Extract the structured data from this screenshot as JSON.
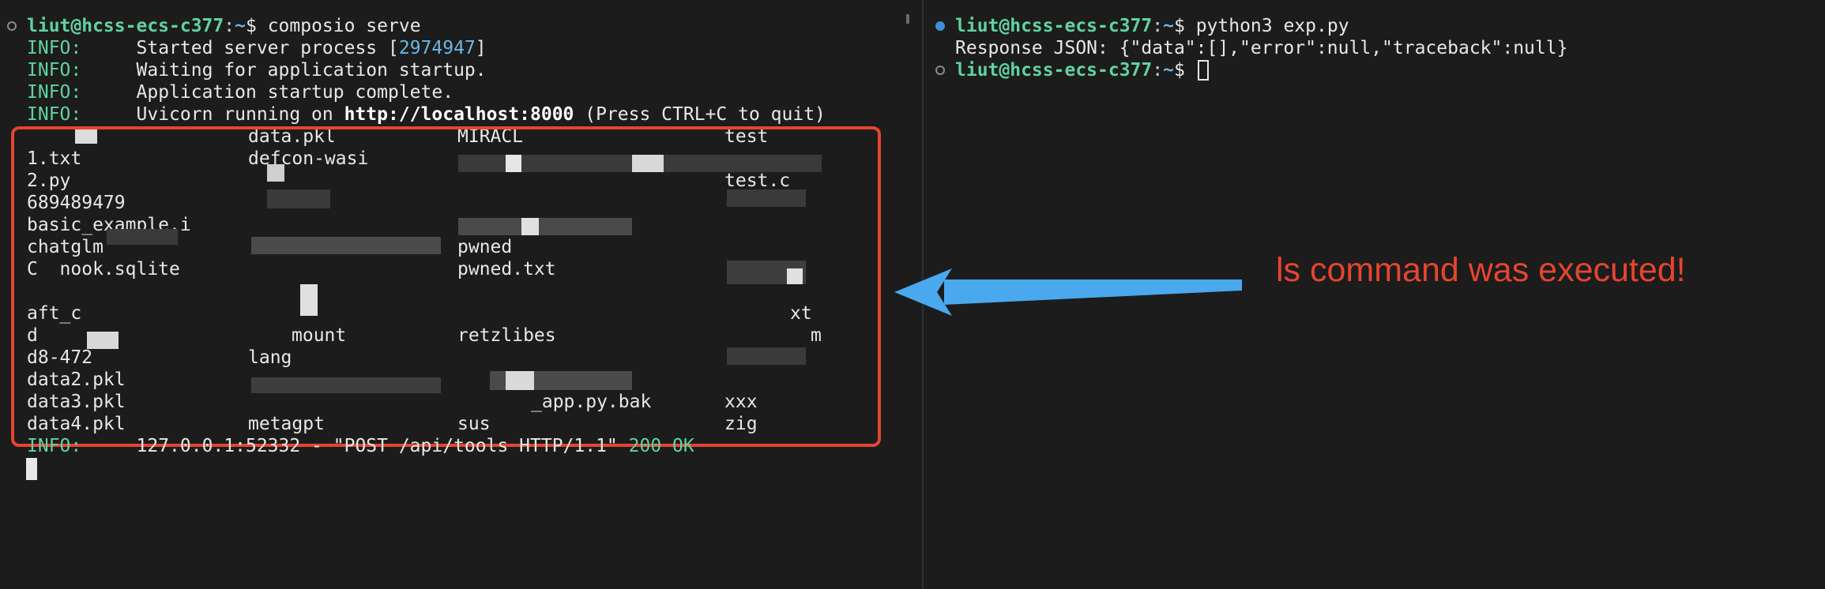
{
  "left_terminal": {
    "prompt": {
      "user_host": "liut@hcss-ecs-c377",
      "colon": ":",
      "path": "~",
      "dollar": "$",
      "command": "composio serve"
    },
    "log": [
      {
        "level": "INFO:",
        "message": "Started server process [",
        "pid": "2974947",
        "suffix": "]"
      },
      {
        "level": "INFO:",
        "message": "Waiting for application startup."
      },
      {
        "level": "INFO:",
        "message": "Application startup complete."
      },
      {
        "level": "INFO:",
        "message": "Uvicorn running on ",
        "url": "http://localhost:8000",
        "suffix": " (Press CTRL+C to quit)"
      }
    ],
    "listing": {
      "col1": [
        "1.txt",
        "2.py",
        "689489479",
        "basic_example.i",
        "chatglm",
        "C",
        "",
        "d",
        "d8-472",
        "data2.pkl",
        "data3.pkl",
        "data4.pkl"
      ],
      "col2": [
        "data.pkl",
        "defcon-wasi",
        "",
        "",
        "",
        "",
        "",
        "",
        "mount",
        "lang",
        "",
        "metagpt"
      ],
      "col3": [
        "MIRACL",
        "",
        "",
        "",
        "",
        "pwned",
        "pwned.txt",
        "",
        "retzlibes",
        "",
        "_app.py.bak",
        "sus"
      ],
      "col4": [
        "test",
        "",
        "test.c",
        "",
        "",
        "",
        "",
        "",
        "xt",
        "m",
        "xxx",
        "zig"
      ]
    },
    "partial_rows": {
      "row_chinook": "C  nook.sqlite",
      "row_draft": "aft_c"
    },
    "request_log": {
      "level": "INFO:",
      "message": "127.0.0.1:52332 - \"POST /api/tools HTTP/1.1\" ",
      "status": "200 OK"
    }
  },
  "right_terminal": {
    "prompt1": {
      "user_host": "liut@hcss-ecs-c377",
      "colon": ":",
      "path": "~",
      "dollar": "$",
      "command": "python3 exp.py"
    },
    "response": "Response JSON: {\"data\":[],\"error\":null,\"traceback\":null}",
    "prompt2": {
      "user_host": "liut@hcss-ecs-c377",
      "colon": ":",
      "path": "~",
      "dollar": "$",
      "command": ""
    }
  },
  "annotation": {
    "text": "ls command was executed!",
    "color": "#e5452f",
    "arrow_color": "#4aa8ee"
  }
}
